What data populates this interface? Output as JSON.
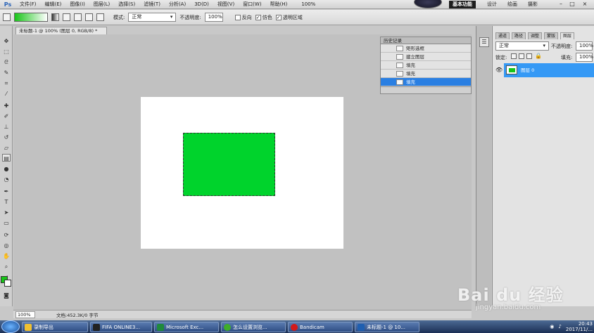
{
  "menubar": {
    "app_icon": "Ps",
    "items": [
      "文件(F)",
      "编辑(E)",
      "图像(I)",
      "图层(L)",
      "选择(S)",
      "滤镜(T)",
      "分析(A)",
      "3D(D)",
      "视图(V)",
      "窗口(W)",
      "帮助(H)"
    ],
    "zoom": "100%",
    "workspaces": {
      "basic": "基本功能",
      "design": "设计",
      "draw": "绘画",
      "photo": "摄影"
    },
    "controls": {
      "minimize": "–",
      "restore": "□",
      "close": "×"
    }
  },
  "options": {
    "mode_label": "模式:",
    "mode_value": "正常",
    "opacity_label": "不透明度:",
    "opacity_value": "100%",
    "reverse": "反向",
    "dither": "仿色",
    "transparency": "透明区域"
  },
  "document": {
    "tab_title": "未标题-1 @ 100% (图层 0, RGB/8) *",
    "status_zoom": "100%",
    "status_info": "文档:452.3K/0 字节",
    "canvas_color": "#ffffff",
    "fill_color": "#00d32c"
  },
  "history": {
    "title": "历史记录",
    "items": [
      {
        "label": "矩形选框",
        "active": false
      },
      {
        "label": "建立图层",
        "active": false
      },
      {
        "label": "填充",
        "active": false
      },
      {
        "label": "填充",
        "active": false
      },
      {
        "label": "填充",
        "active": true
      }
    ]
  },
  "layers": {
    "tabs": [
      "图层",
      "通道",
      "路径",
      "调整",
      "蒙版"
    ],
    "blend_mode": "正常",
    "opacity_label": "不透明度:",
    "opacity_value": "100%",
    "lock_label": "锁定:",
    "fill_label": "填充:",
    "fill_value": "100%",
    "layer_name": "图层 0"
  },
  "taskbar": {
    "buttons": [
      {
        "label": "录制导出",
        "color": "#f0c030"
      },
      {
        "label": "FIFA ONLINE3...",
        "color": "#222222"
      },
      {
        "label": "Microsoft Exc...",
        "color": "#1f8a3c"
      },
      {
        "label": "怎么设置浏览...",
        "color": "#3fae2a"
      },
      {
        "label": "Bandicam",
        "color": "#d21a1a"
      },
      {
        "label": "未标题-1 @ 10...",
        "color": "#1f5fb0"
      }
    ],
    "clock": "20:43",
    "date": "2017/11/..."
  },
  "watermark": {
    "brand": "Bai du 经验",
    "url": "jingyan.baidu.com"
  }
}
